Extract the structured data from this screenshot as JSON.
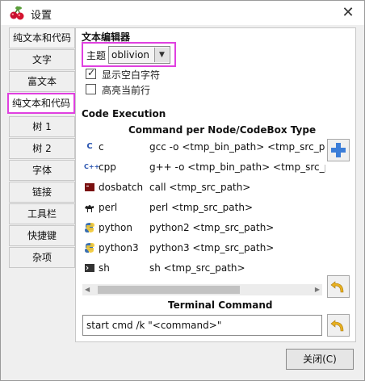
{
  "window": {
    "title": "设置",
    "icon": "cherry-icon",
    "close_glyph": "✕"
  },
  "sidebar": {
    "items": [
      {
        "label": "纯文本和代码",
        "selected": false
      },
      {
        "label": "文字",
        "selected": false
      },
      {
        "label": "富文本",
        "selected": false
      },
      {
        "label": "纯文本和代码",
        "selected": true
      },
      {
        "label": "树 1",
        "selected": false
      },
      {
        "label": "树 2",
        "selected": false
      },
      {
        "label": "字体",
        "selected": false
      },
      {
        "label": "链接",
        "selected": false
      },
      {
        "label": "工具栏",
        "selected": false
      },
      {
        "label": "快捷键",
        "selected": false
      },
      {
        "label": "杂项",
        "selected": false
      }
    ]
  },
  "editor": {
    "section_title": "文本编辑器",
    "theme_label": "主题",
    "theme_value": "oblivion",
    "show_whitespace": {
      "label": "显示空白字符",
      "checked": true
    },
    "highlight_line": {
      "label": "高亮当前行",
      "checked": false
    }
  },
  "execution": {
    "section_title": "Code Execution",
    "table_header": "Command per Node/CodeBox Type",
    "rows": [
      {
        "lang": "c",
        "icon": "c-icon",
        "cmd": "gcc -o <tmp_bin_path> <tmp_src_path>"
      },
      {
        "lang": "cpp",
        "icon": "cpp-icon",
        "cmd": "g++ -o <tmp_bin_path> <tmp_src_path>"
      },
      {
        "lang": "dosbatch",
        "icon": "dosbatch-icon",
        "cmd": "call <tmp_src_path>"
      },
      {
        "lang": "perl",
        "icon": "perl-camel-icon",
        "cmd": "perl <tmp_src_path>"
      },
      {
        "lang": "python",
        "icon": "python-icon",
        "cmd": "python2 <tmp_src_path>"
      },
      {
        "lang": "python3",
        "icon": "python-icon",
        "cmd": "python3 <tmp_src_path>"
      },
      {
        "lang": "sh",
        "icon": "terminal-icon",
        "cmd": "sh <tmp_src_path>"
      }
    ],
    "terminal_title": "Terminal Command",
    "terminal_value": "start cmd /k \"<command>\""
  },
  "footer": {
    "close_label": "关闭(C)"
  },
  "colors": {
    "highlight": "#e040e0",
    "add_button": "#3b7dd8",
    "undo_arrow": "#e8b020"
  }
}
